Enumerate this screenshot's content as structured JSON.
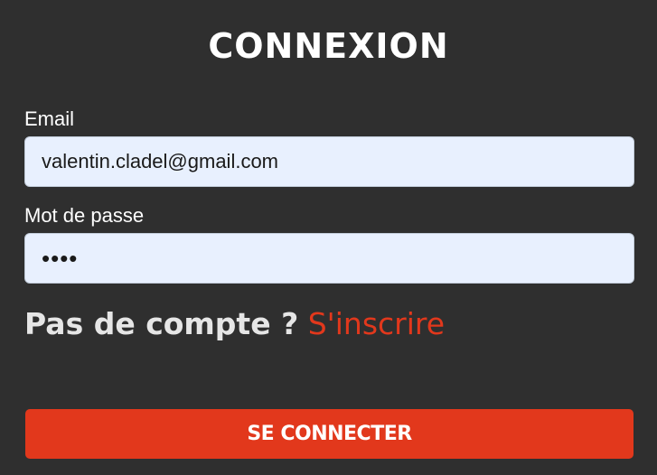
{
  "form": {
    "title": "CONNEXION",
    "email": {
      "label": "Email",
      "value": "valentin.cladel@gmail.com"
    },
    "password": {
      "label": "Mot de passe",
      "value": "pass"
    },
    "register": {
      "prompt": "Pas de compte ?",
      "link": "S'inscrire"
    },
    "submit_label": "SE CONNECTER"
  },
  "colors": {
    "background": "#2f2f2f",
    "accent": "#e2381c",
    "input_background": "#e8f0fe"
  }
}
